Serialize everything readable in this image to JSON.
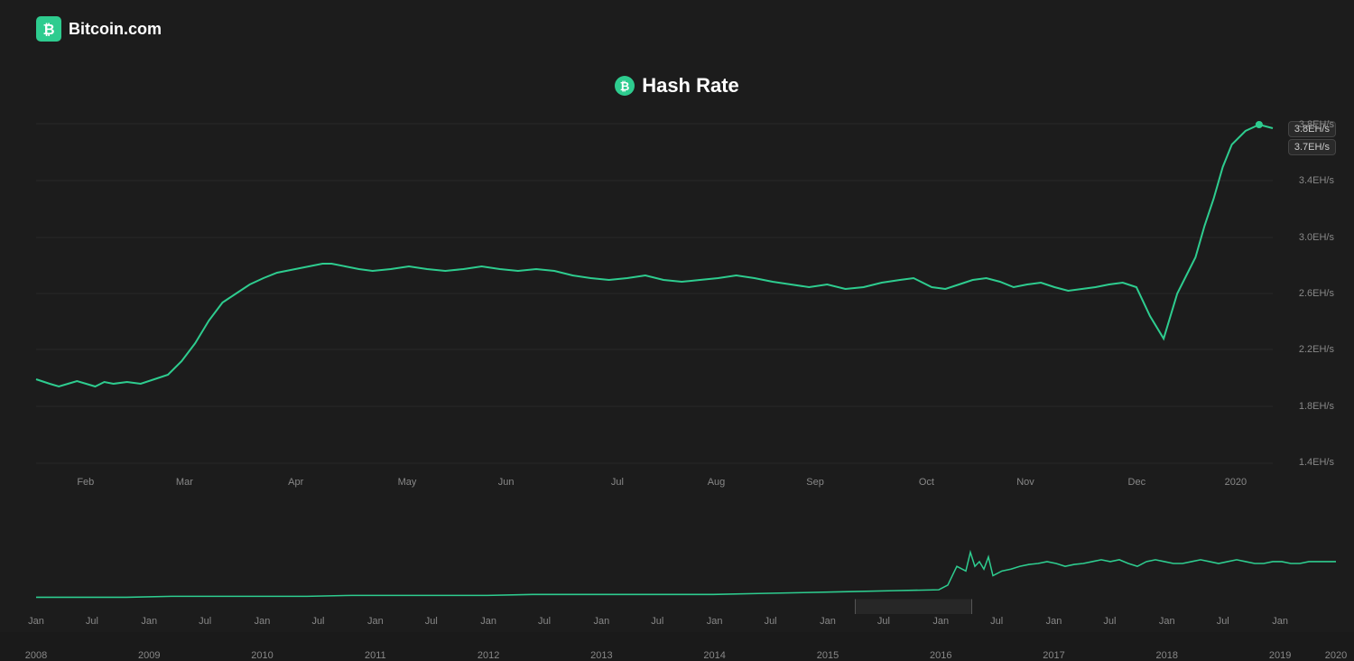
{
  "logo": {
    "text": "Bitcoin.com",
    "icon_color": "#2ecc8f"
  },
  "chart": {
    "title": "Hash Rate",
    "title_icon": "bitcoin-icon",
    "accent_color": "#2ecc8f",
    "y_axis": {
      "labels": [
        "3.8EH/s",
        "3.4EH/s",
        "3.0EH/s",
        "2.6EH/s",
        "2.2EH/s",
        "1.8EH/s",
        "1.4EH/s"
      ],
      "positions_pct": [
        2,
        18,
        34,
        50,
        66,
        82,
        98
      ]
    },
    "x_axis_main": {
      "labels": [
        "Feb",
        "Mar",
        "Apr",
        "May",
        "Jun",
        "Jul",
        "Aug",
        "Sep",
        "Oct",
        "Nov",
        "Dec",
        "2020"
      ],
      "positions_pct": [
        4,
        12,
        21,
        30,
        38,
        47,
        55,
        63,
        72,
        80,
        89,
        97
      ]
    },
    "current_values": [
      "3.8EH/s",
      "3.7EH/s"
    ],
    "x_axis_overview": {
      "labels": [
        "Jan",
        "Jul",
        "Jan",
        "Jul",
        "Jan",
        "Jul",
        "Jan",
        "Jul",
        "Jan",
        "Jul",
        "Jan",
        "Jul",
        "Jan",
        "Jul",
        "Jan",
        "Jul",
        "Jan",
        "Jul",
        "Jan",
        "Jul",
        "Jan",
        "Jul"
      ],
      "years": [
        "2008",
        "",
        "2009",
        "",
        "2010",
        "",
        "2011",
        "",
        "2012",
        "",
        "2013",
        "",
        "2014",
        "",
        "2015",
        "",
        "2016",
        "",
        "2017",
        "",
        "2018",
        "",
        "2019",
        "",
        "2020"
      ],
      "year_positions_pct": [
        0,
        8.7,
        17.4,
        26.1,
        34.8,
        43.5,
        52.2,
        60.9,
        69.6,
        78.3,
        87.0,
        95.7
      ]
    },
    "overview_selection": {
      "left_pct": 63,
      "width_pct": 8
    }
  }
}
